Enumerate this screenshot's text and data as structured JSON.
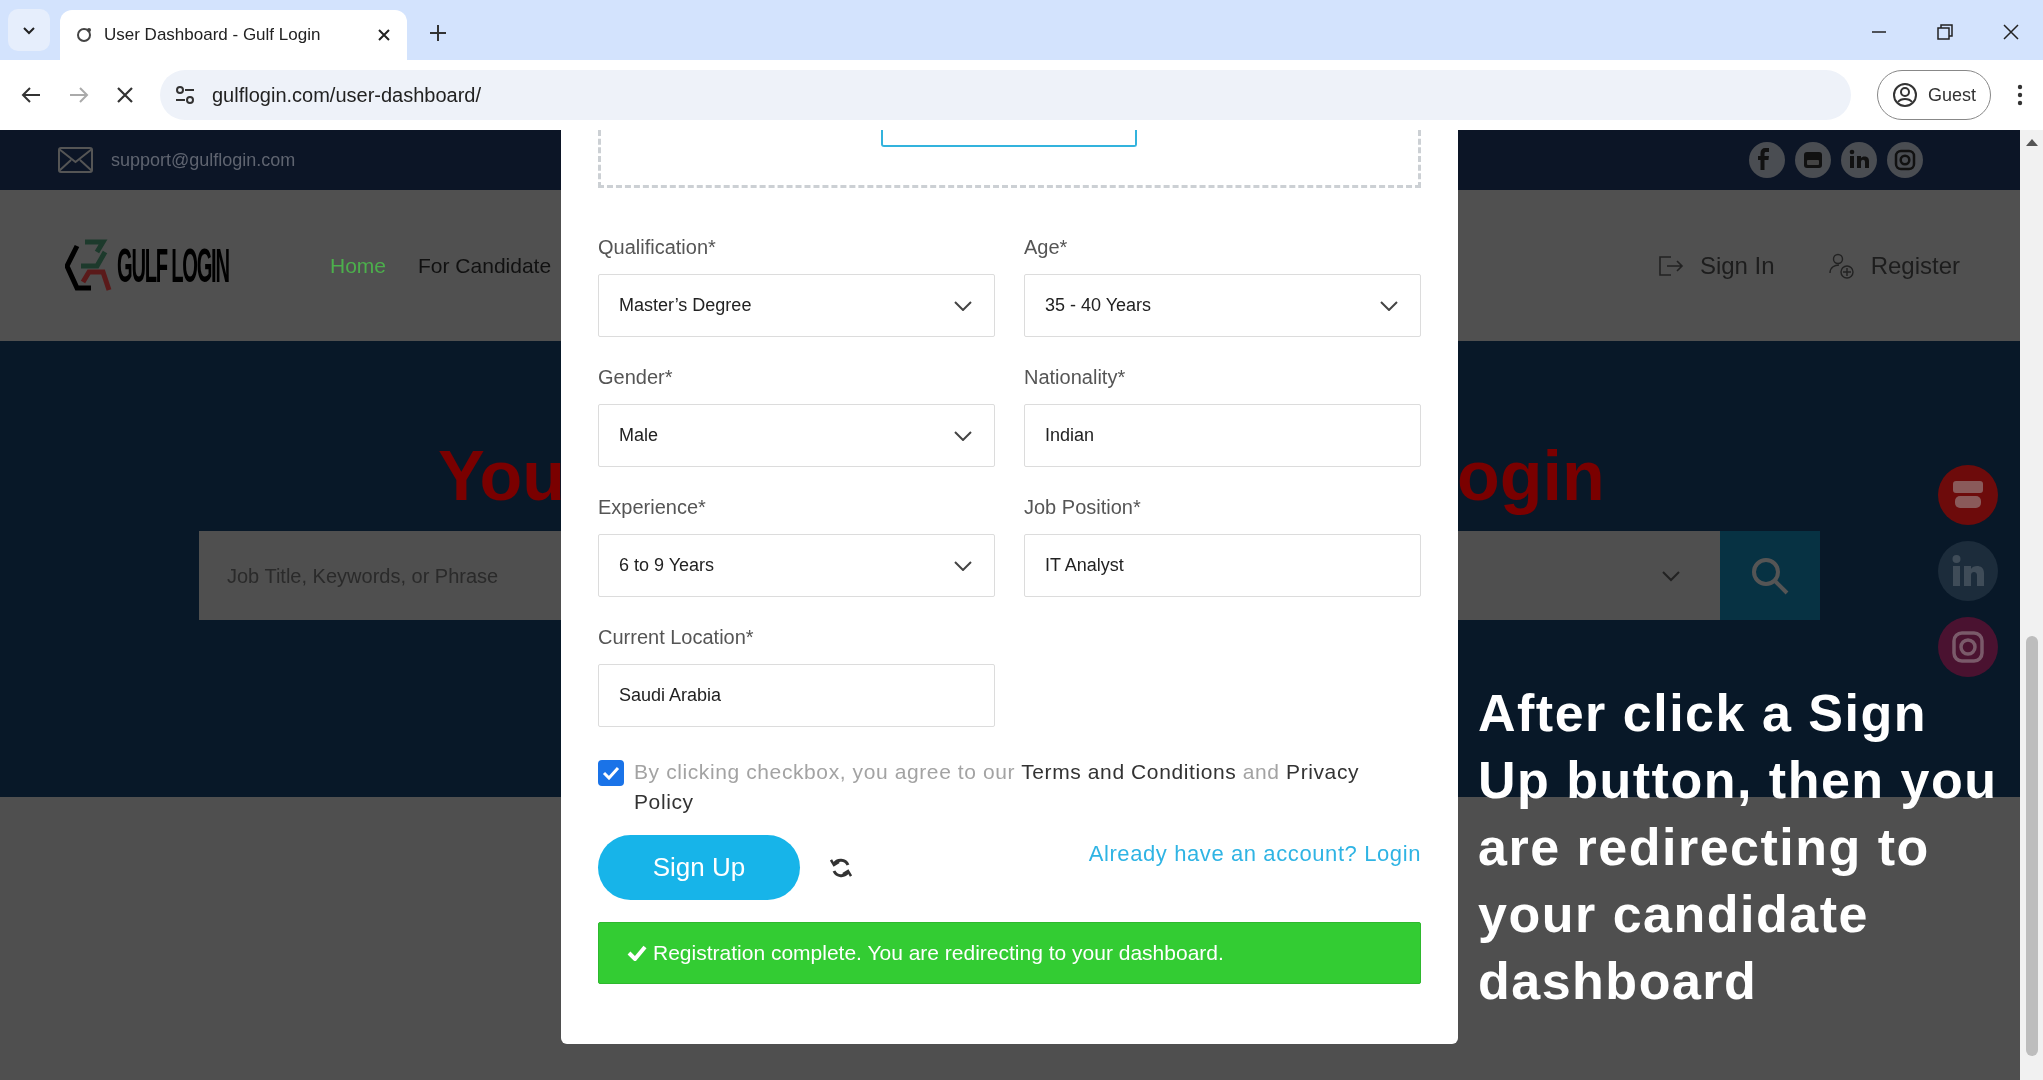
{
  "browser": {
    "tab_title": "User Dashboard - Gulf Login",
    "url": "gulflogin.com/user-dashboard/",
    "profile": "Guest"
  },
  "top_bar": {
    "email": "support@gulflogin.com"
  },
  "header": {
    "logo": "GULF LOGIN",
    "nav": [
      {
        "label": "Home",
        "selected": true
      },
      {
        "label": "For Candidate",
        "selected": false
      }
    ],
    "sign_in": "Sign In",
    "register": "Register"
  },
  "hero": {
    "title_left": "You",
    "title_right": "ogin",
    "search_placeholder": "Job Title, Keywords, or Phrase"
  },
  "form": {
    "fields": [
      {
        "label": "Qualification*",
        "value": "Master’s Degree",
        "kind": "select"
      },
      {
        "label": "Age*",
        "value": "35 - 40 Years",
        "kind": "select"
      },
      {
        "label": "Gender*",
        "value": "Male",
        "kind": "select"
      },
      {
        "label": "Nationality*",
        "value": "Indian",
        "kind": "text"
      },
      {
        "label": "Experience*",
        "value": "6 to 9 Years",
        "kind": "select"
      },
      {
        "label": "Job Position*",
        "value": "IT Analyst",
        "kind": "text"
      },
      {
        "label": "Current Location*",
        "value": "Saudi Arabia",
        "kind": "text"
      }
    ],
    "consent": {
      "checked": true,
      "text": "By clicking checkbox, you agree to our **Terms and Conditions** and **Privacy Policy**"
    },
    "sign_up": "Sign Up",
    "login_link": "Already have an account? Login",
    "success": "Registration complete. You are redirecting to your dashboard."
  },
  "annotation": "After click a Sign Up button, then you are redirecting to your candidate dashboard"
}
